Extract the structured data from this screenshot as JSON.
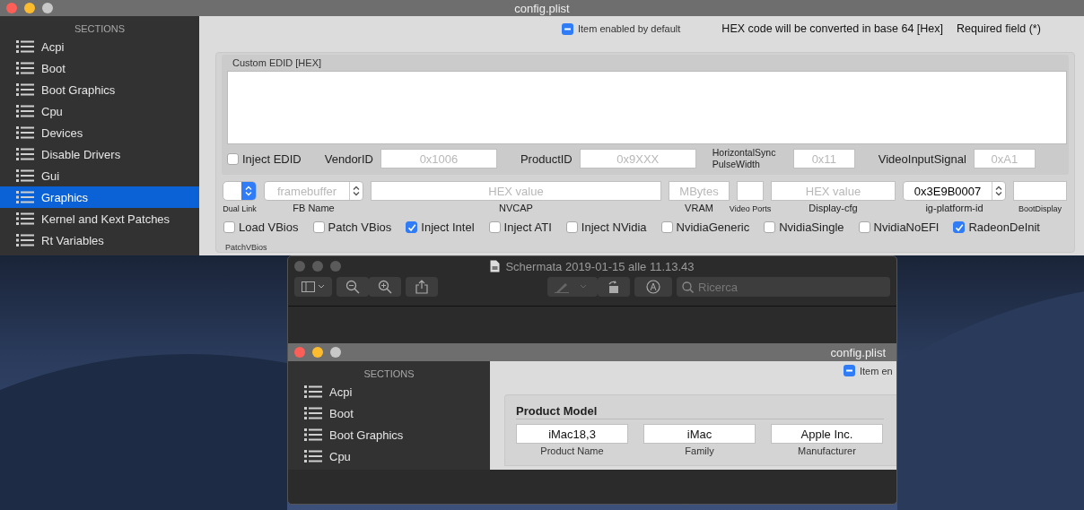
{
  "config_window": {
    "title": "config.plist",
    "sidebar": {
      "heading": "SECTIONS",
      "items": [
        {
          "label": "Acpi",
          "selected": false
        },
        {
          "label": "Boot",
          "selected": false
        },
        {
          "label": "Boot Graphics",
          "selected": false
        },
        {
          "label": "Cpu",
          "selected": false
        },
        {
          "label": "Devices",
          "selected": false
        },
        {
          "label": "Disable Drivers",
          "selected": false
        },
        {
          "label": "Gui",
          "selected": false
        },
        {
          "label": "Graphics",
          "selected": true
        },
        {
          "label": "Kernel and Kext Patches",
          "selected": false
        },
        {
          "label": "Rt Variables",
          "selected": false
        }
      ]
    },
    "legend": {
      "enabled_label": "Item enabled by default",
      "hex_note": "HEX code will be converted in base 64 [Hex]",
      "required_note": "Required field (*)"
    },
    "edid": {
      "title": "Custom EDID [HEX]",
      "inject": {
        "label": "Inject EDID",
        "checked": false
      },
      "fields": [
        {
          "label": "VendorID",
          "placeholder": "0x1006"
        },
        {
          "label": "ProductID",
          "placeholder": "0x9XXX"
        },
        {
          "label": "HorizontalSync PulseWidth",
          "placeholder": "0x11"
        },
        {
          "label": "VideoInputSignal",
          "placeholder": "0xA1"
        }
      ]
    },
    "graphics_fields": [
      {
        "kind": "popup",
        "label": "Dual Link"
      },
      {
        "kind": "combo",
        "label": "FB Name",
        "placeholder": "framebuffer"
      },
      {
        "kind": "text",
        "label": "NVCAP",
        "placeholder": "HEX value"
      },
      {
        "kind": "text",
        "label": "VRAM",
        "placeholder": "MBytes"
      },
      {
        "kind": "text",
        "label": "Video Ports"
      },
      {
        "kind": "text",
        "label": "Display-cfg",
        "placeholder": "HEX value"
      },
      {
        "kind": "combo",
        "label": "ig-platform-id",
        "value": "0x3E9B0007"
      },
      {
        "kind": "text",
        "label": "BootDisplay"
      }
    ],
    "options": [
      {
        "label": "Load VBios",
        "checked": false
      },
      {
        "label": "Patch VBios",
        "checked": false
      },
      {
        "label": "Inject Intel",
        "checked": true
      },
      {
        "label": "Inject ATI",
        "checked": false
      },
      {
        "label": "Inject NVidia",
        "checked": false
      },
      {
        "label": "NvidiaGeneric",
        "checked": false
      },
      {
        "label": "NvidiaSingle",
        "checked": false
      },
      {
        "label": "NvidiaNoEFI",
        "checked": false
      },
      {
        "label": "RadeonDeInit",
        "checked": true
      }
    ],
    "next_section": "PatchVBios"
  },
  "preview_window": {
    "title": "Schermata 2019-01-15 alle 11.13.43",
    "search": {
      "placeholder": "Ricerca"
    },
    "screenshot": {
      "title": "config.plist",
      "sidebar": {
        "heading": "SECTIONS",
        "items": [
          {
            "label": "Acpi",
            "selected": false
          },
          {
            "label": "Boot",
            "selected": false
          },
          {
            "label": "Boot Graphics",
            "selected": false
          },
          {
            "label": "Cpu",
            "selected": false
          }
        ]
      },
      "enabled_label": "Item en",
      "product_model": {
        "title": "Product Model",
        "fields": [
          {
            "label": "Product Name",
            "value": "iMac18,3"
          },
          {
            "label": "Family",
            "value": "iMac"
          },
          {
            "label": "Manufacturer",
            "value": "Apple Inc."
          }
        ]
      }
    }
  }
}
